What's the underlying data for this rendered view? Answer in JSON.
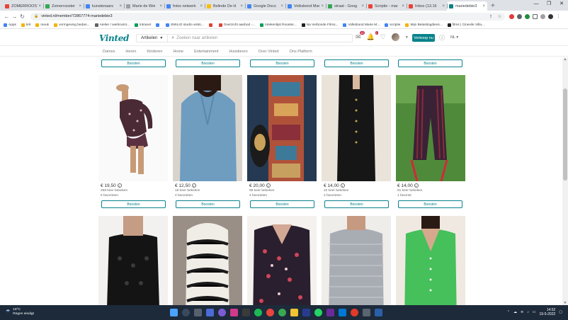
{
  "tabs": [
    {
      "label": "ZOMERROOSTER",
      "color": "#ea4335",
      "active": false
    },
    {
      "label": "Zomerrooster",
      "color": "#34a853",
      "active": false
    },
    {
      "label": "kunstenaars",
      "color": "#4285f4",
      "active": false
    },
    {
      "label": "Marie de Wei",
      "color": "#9aa0a6",
      "active": false
    },
    {
      "label": "fotos netwerk",
      "color": "#4285f4",
      "active": false
    },
    {
      "label": "Belinde De H",
      "color": "#fbbc05",
      "active": false
    },
    {
      "label": "Google Docs",
      "color": "#4285f4",
      "active": false
    },
    {
      "label": "Volksbond Mar",
      "color": "#4285f4",
      "active": false
    },
    {
      "label": "straat - Goog",
      "color": "#34a853",
      "active": false
    },
    {
      "label": "Scriptie - mar",
      "color": "#ea4335",
      "active": false
    },
    {
      "label": "Inbox (13.16",
      "color": "#ea4335",
      "active": false
    },
    {
      "label": "mariedebie3",
      "color": "#09828c",
      "active": true
    }
  ],
  "address": {
    "url": "vinted.nl/member/72867774-mariedebie3"
  },
  "bookmarks": [
    {
      "label": "Apps",
      "color": "#4285f4"
    },
    {
      "label": "krit",
      "color": "#f4b400"
    },
    {
      "label": "meuk",
      "color": "#f4b400"
    },
    {
      "label": "vormgeving bedan...",
      "color": "#f4b400"
    },
    {
      "label": "Atelier / werkruimt...",
      "color": "#5f6368"
    },
    {
      "label": "Intranet",
      "color": "#0f9d58"
    },
    {
      "label": "",
      "color": "#4285f4"
    },
    {
      "label": "EMILIO studio visits...",
      "color": "#4285f4"
    },
    {
      "label": "",
      "color": "#db4437"
    },
    {
      "label": "Overzicht aanbod -...",
      "color": "#db4437"
    },
    {
      "label": "Intekenlijst Rooster...",
      "color": "#0f9d58"
    },
    {
      "label": "Na Verbonde Films...",
      "color": "#202124"
    },
    {
      "label": "Volksbond Marie M...",
      "color": "#4285f4"
    },
    {
      "label": "scriptie",
      "color": "#4285f4"
    },
    {
      "label": "Mijn Belastingdiens...",
      "color": "#f4b400"
    },
    {
      "label": "films | Cinevile Villa...",
      "color": "#202124"
    }
  ],
  "header": {
    "logo": "Vinted",
    "search_category": "Artikelen",
    "search_placeholder": "Zoeken naar artikelen",
    "inbox_badge": "45",
    "notif_badge": "1",
    "sell_label": "Verkoop nu",
    "lang": "NL"
  },
  "nav": [
    "Dames",
    "Heren",
    "Kinderen",
    "Home",
    "Entertainment",
    "Huisdieren",
    "Over Vinted",
    "Ons Platform"
  ],
  "bump_label": "Boosten",
  "items_row1": [
    {
      "price": "€ 19,50",
      "views": "258 keer bekeken",
      "favs": "6 favorieten"
    },
    {
      "price": "€ 12,50",
      "views": "18 keer bekeken",
      "favs": "4 favorieten"
    },
    {
      "price": "€ 20,00",
      "views": "98 keer bekeken",
      "favs": "4 favorieten"
    },
    {
      "price": "€ 14,00",
      "views": "22 keer bekeken",
      "favs": "2 favorieten"
    },
    {
      "price": "€ 14,00",
      "views": "81 keer bekeken",
      "favs": "1 favoriet"
    }
  ],
  "taskbar": {
    "temp": "18°C",
    "weather": "Regen eindigt",
    "time": "14:52",
    "date": "19-5-2022"
  }
}
